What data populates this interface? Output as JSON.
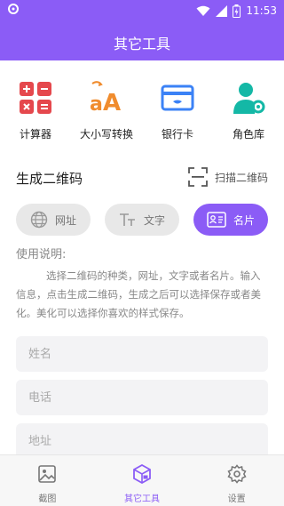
{
  "status_bar": {
    "time": "11:53"
  },
  "app_bar": {
    "title": "其它工具"
  },
  "tools": [
    {
      "label": "计算器",
      "icon": "calculator-icon"
    },
    {
      "label": "大小写转换",
      "icon": "case-convert-icon"
    },
    {
      "label": "银行卡",
      "icon": "bank-card-icon"
    },
    {
      "label": "角色库",
      "icon": "role-library-icon"
    }
  ],
  "qr": {
    "title": "生成二维码",
    "scan_label": "扫描二维码",
    "types": [
      {
        "label": "网址",
        "icon": "globe-icon",
        "active": false
      },
      {
        "label": "文字",
        "icon": "text-icon",
        "active": false
      },
      {
        "label": "名片",
        "icon": "card-icon",
        "active": true
      }
    ],
    "usage_title": "使用说明:",
    "usage_text": "选择二维码的种类，网址，文字或者名片。输入信息，点击生成二维码，生成之后可以选择保存或者美化。美化可以选择你喜欢的样式保存。",
    "fields": {
      "name_placeholder": "姓名",
      "phone_placeholder": "电话",
      "address_placeholder": "地址"
    }
  },
  "bottom_nav": [
    {
      "label": "截图",
      "icon": "screenshot-icon",
      "active": false
    },
    {
      "label": "其它工具",
      "icon": "tools-box-icon",
      "active": true
    },
    {
      "label": "设置",
      "icon": "settings-gear-icon",
      "active": false
    }
  ],
  "colors": {
    "accent": "#8b5cf6",
    "red": "#e5484d",
    "orange": "#f08c2e",
    "blue": "#3b82f6",
    "teal": "#14b8a6"
  }
}
